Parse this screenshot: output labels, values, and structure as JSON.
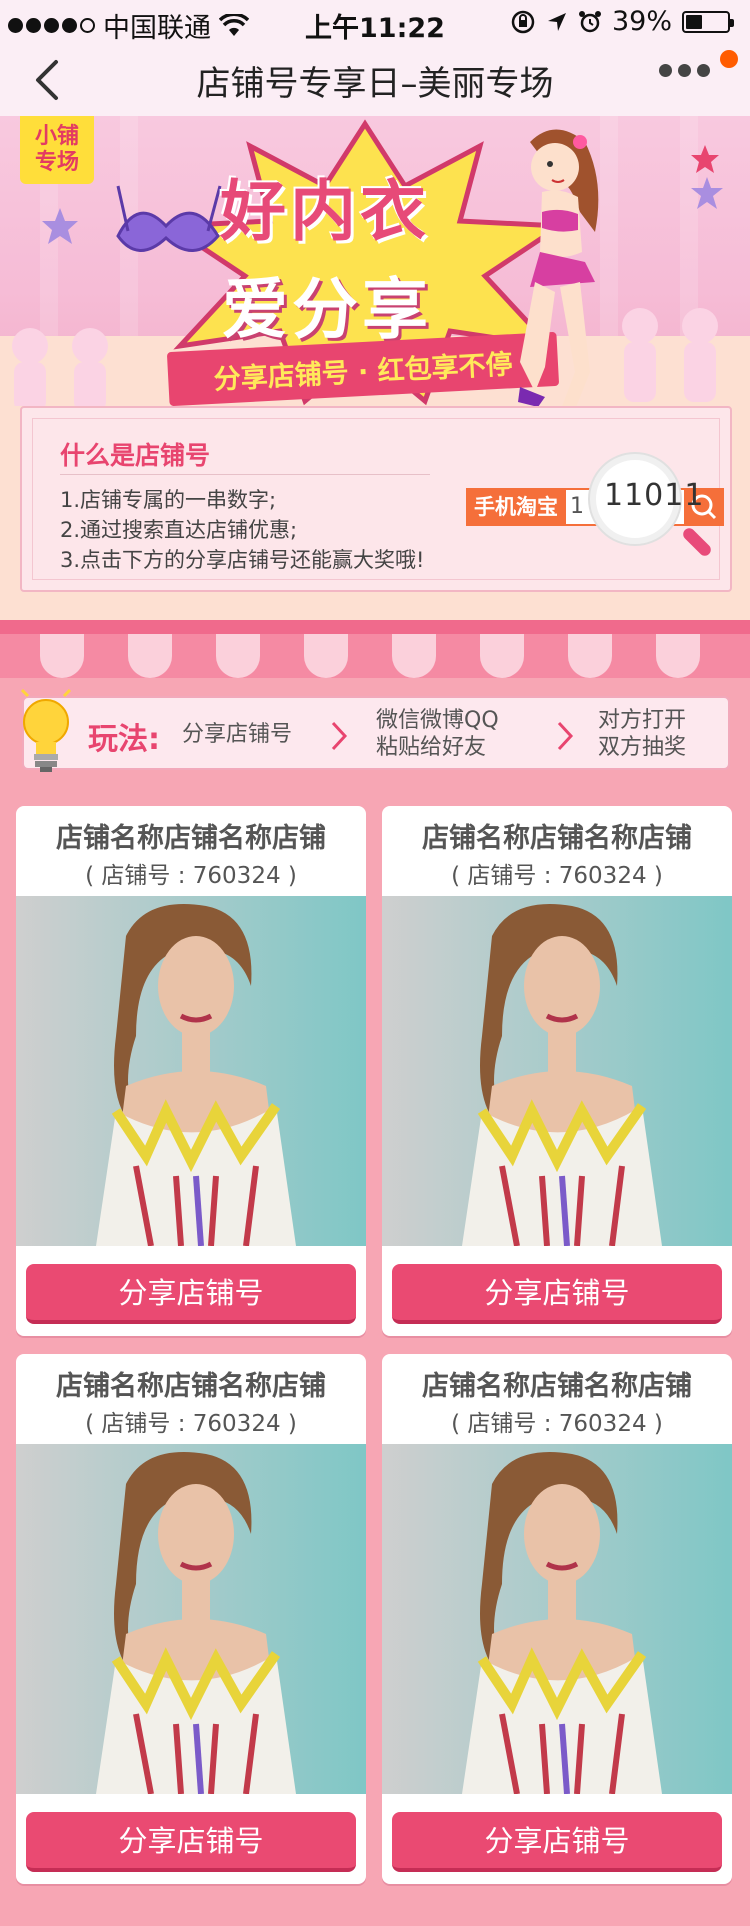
{
  "status_bar": {
    "carrier": "中国联通",
    "time": "上午11:22",
    "battery": "39%",
    "battery_level": 0.39
  },
  "nav": {
    "title": "店铺号专享日–美丽专场"
  },
  "banner": {
    "tag_line1": "小铺",
    "tag_line2": "专场",
    "headline1": "好内衣",
    "headline2": "爱分享",
    "ribbon": "分享店铺号 · 红包享不停"
  },
  "info": {
    "title": "什么是店铺号",
    "lines": [
      "1.店铺专属的一串数字;",
      "2.通过搜索直达店铺优惠;",
      "3.点击下方的分享店铺号还能赢大奖哦!"
    ],
    "search_label": "手机淘宝",
    "search_prefix": "1",
    "magnified_number": "11011"
  },
  "howto": {
    "label": "玩法:",
    "step1": "分享店铺号",
    "step2_line1": "微信微博QQ",
    "step2_line2": "粘贴给好友",
    "step3_line1": "对方打开",
    "step3_line2": "双方抽奖"
  },
  "shops": [
    {
      "name": "店铺名称店铺名称店铺",
      "id": "( 店铺号 : 760324 )",
      "button": "分享店铺号"
    },
    {
      "name": "店铺名称店铺名称店铺",
      "id": "( 店铺号 : 760324 )",
      "button": "分享店铺号"
    },
    {
      "name": "店铺名称店铺名称店铺",
      "id": "( 店铺号 : 760324 )",
      "button": "分享店铺号"
    },
    {
      "name": "店铺名称店铺名称店铺",
      "id": "( 店铺号 : 760324 )",
      "button": "分享店铺号"
    }
  ],
  "icons": {
    "back": "back-arrow-icon",
    "more": "more-dots-icon",
    "wifi": "wifi-icon",
    "location": "location-arrow-icon",
    "alarm": "alarm-icon",
    "lock": "rotation-lock-icon",
    "bulb": "lightbulb-icon",
    "search": "search-icon"
  },
  "colors": {
    "accent": "#e8456f",
    "button": "#ea4a72",
    "page_bg": "#f7a6b4",
    "search_orange": "#f56f3a"
  }
}
